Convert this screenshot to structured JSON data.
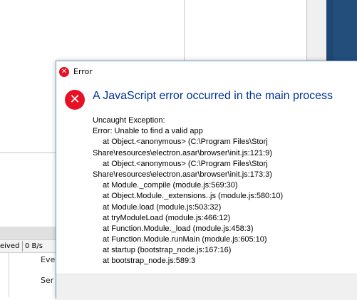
{
  "background": {
    "status_bar": {
      "label_a": "eived",
      "label_b": "0 B/s"
    },
    "list_items": [
      "Eve",
      "Ser"
    ]
  },
  "dialog": {
    "title": "Error",
    "message": "A JavaScript error occurred in the main process",
    "detail_lines": [
      {
        "text": "Uncaught Exception:",
        "indent": false
      },
      {
        "text": "Error: Unable to find a valid app",
        "indent": false
      },
      {
        "text": "at Object.<anonymous> (C:\\Program Files\\Storj",
        "indent": true
      },
      {
        "text": "Share\\resources\\electron.asar\\browser\\init.js:121:9)",
        "indent": false
      },
      {
        "text": "at Object.<anonymous> (C:\\Program Files\\Storj",
        "indent": true
      },
      {
        "text": "Share\\resources\\electron.asar\\browser\\init.js:173:3)",
        "indent": false
      },
      {
        "text": "at Module._compile (module.js:569:30)",
        "indent": true
      },
      {
        "text": "at Object.Module._extensions..js (module.js:580:10)",
        "indent": true
      },
      {
        "text": "at Module.load (module.js:503:32)",
        "indent": true
      },
      {
        "text": "at tryModuleLoad (module.js:466:12)",
        "indent": true
      },
      {
        "text": "at Function.Module._load (module.js:458:3)",
        "indent": true
      },
      {
        "text": "at Function.Module.runMain (module.js:605:10)",
        "indent": true
      },
      {
        "text": "at startup (bootstrap_node.js:167:16)",
        "indent": true
      },
      {
        "text": "at bootstrap_node.js:589:3",
        "indent": true
      }
    ],
    "icons": {
      "title": "error-icon",
      "main": "error-icon"
    },
    "colors": {
      "error_red": "#e81123",
      "message_blue": "#003399"
    }
  }
}
